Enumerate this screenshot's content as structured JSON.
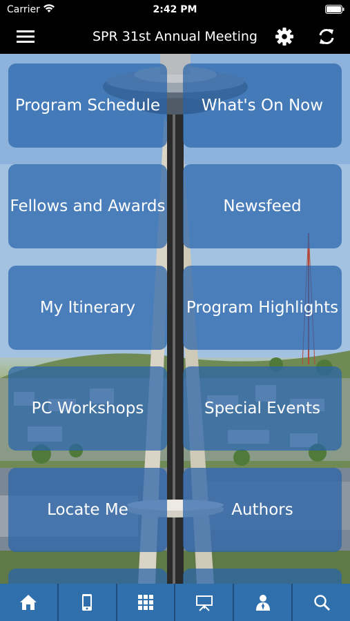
{
  "status_bar": {
    "carrier": "Carrier",
    "time": "2:42 PM"
  },
  "nav": {
    "title": "SPR 31st Annual Meeting",
    "icons": [
      "menu-icon",
      "gear-icon",
      "refresh-icon"
    ]
  },
  "tiles": [
    {
      "label": "Program Schedule"
    },
    {
      "label": "What's On Now"
    },
    {
      "label": "Fellows and Awards"
    },
    {
      "label": "Newsfeed"
    },
    {
      "label": "My Itinerary"
    },
    {
      "label": "Program Highlights"
    },
    {
      "label": "PC Workshops"
    },
    {
      "label": "Special Events"
    },
    {
      "label": "Locate Me"
    },
    {
      "label": "Authors"
    }
  ],
  "tab_bar": {
    "tabs": [
      "home-icon",
      "phone-icon",
      "grid-icon",
      "presentation-icon",
      "user-icon",
      "search-icon"
    ]
  },
  "colors": {
    "tile": "#2864aa",
    "tab_bar": "#2f6fac",
    "nav_background": "#000000"
  }
}
